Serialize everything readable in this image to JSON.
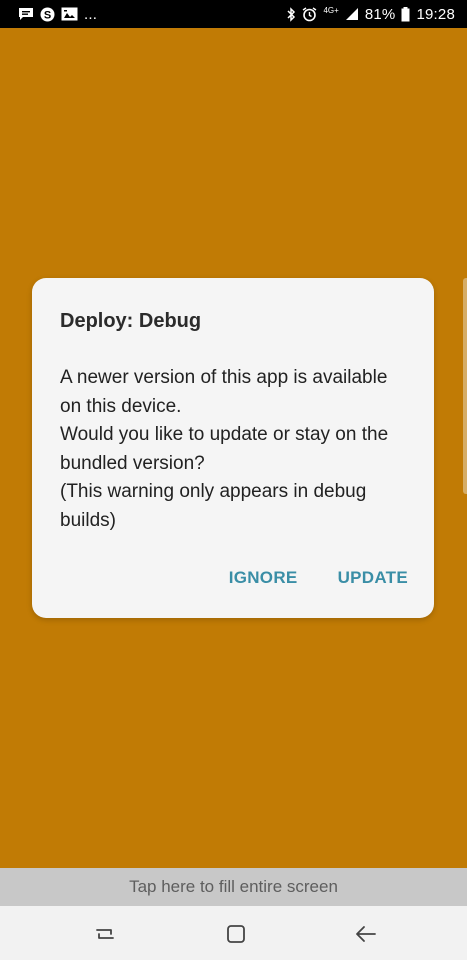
{
  "status_bar": {
    "overflow": "...",
    "network": "4G+",
    "battery": "81%",
    "time": "19:28",
    "icons_left": [
      "message-icon",
      "skype-icon",
      "gallery-icon"
    ],
    "icons_right": [
      "bluetooth-icon",
      "alarm-icon",
      "signal-icon",
      "battery-icon"
    ]
  },
  "dialog": {
    "title": "Deploy: Debug",
    "body_lines": [
      "A newer version of this app is available",
      "on this device.",
      "Would you like to update or stay on the",
      "bundled version?",
      "(This warning only appears in debug",
      "builds)"
    ],
    "ignore_label": "IGNORE",
    "update_label": "UPDATE"
  },
  "fill_screen_bar": {
    "label": "Tap here to fill entire screen"
  },
  "nav_bar": {
    "icons": [
      "recents-icon",
      "home-icon",
      "back-icon"
    ]
  },
  "colors": {
    "background": "#c17b05",
    "dialog_bg": "#f5f5f5",
    "accent": "#3a8ea6",
    "status_bar": "#000000"
  }
}
